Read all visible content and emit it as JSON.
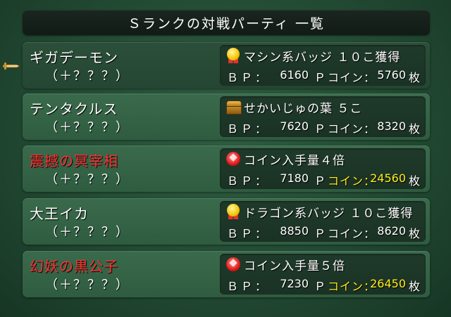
{
  "title": "Ｓランクの対戦パーティ 一覧",
  "labels": {
    "bp": "ＢＰ：",
    "p_unit": "Ｐ",
    "coin": "コイン：",
    "coin_unit": "枚"
  },
  "rows": [
    {
      "name": "ギガデーモン",
      "level": "（＋？？？）",
      "reward": "マシン系バッジ １０こ獲得",
      "reward_icon": "medal-icon",
      "bp": "6160",
      "coins": "5760",
      "name_color": "white",
      "coin_highlight": false,
      "selected": true
    },
    {
      "name": "テンタクルス",
      "level": "（＋？？？）",
      "reward": "せかいじゅの葉 ５こ",
      "reward_icon": "treasure-chest-icon",
      "bp": "7620",
      "coins": "8320",
      "name_color": "white",
      "coin_highlight": false,
      "selected": false
    },
    {
      "name": "震撼の冥宰相",
      "level": "（＋？？？）",
      "reward": "コイン入手量４倍",
      "reward_icon": "red-gem-icon",
      "bp": "7180",
      "coins": "24560",
      "name_color": "#ff3030",
      "coin_highlight": true,
      "selected": false
    },
    {
      "name": "大王イカ",
      "level": "（＋？？？）",
      "reward": "ドラゴン系バッジ １０こ獲得",
      "reward_icon": "medal-icon",
      "bp": "8850",
      "coins": "8620",
      "name_color": "white",
      "coin_highlight": false,
      "selected": false
    },
    {
      "name": "幻妖の黒公子",
      "level": "（＋？？？）",
      "reward": "コイン入手量５倍",
      "reward_icon": "red-gem-icon",
      "bp": "7230",
      "coins": "26450",
      "name_color": "#ff3030",
      "coin_highlight": true,
      "selected": false
    }
  ],
  "colors": {
    "background": "#224a33",
    "highlight_text": "#ffee1a",
    "boss_name": "#ff3030"
  },
  "cursor_icon": "sword-cursor-icon"
}
